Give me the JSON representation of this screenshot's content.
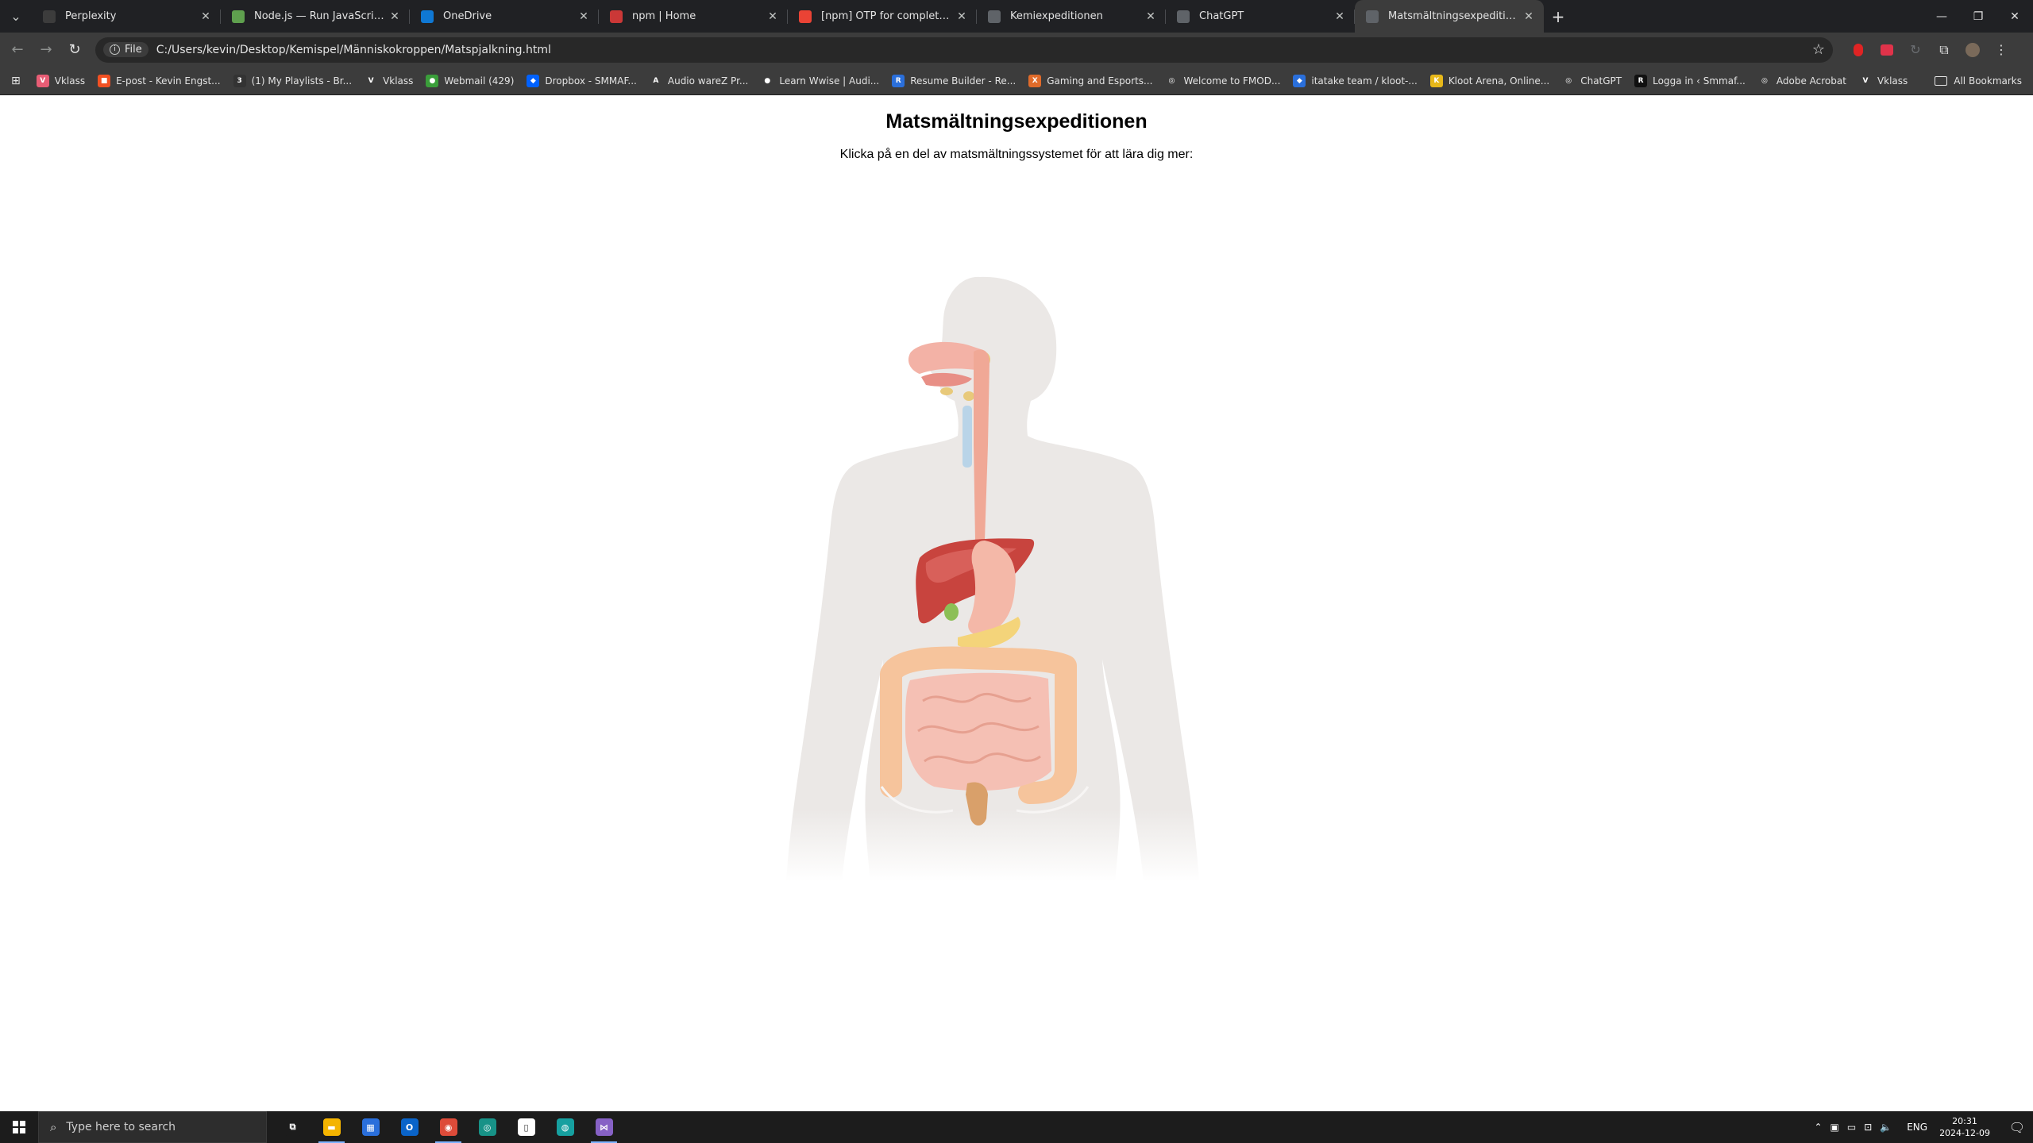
{
  "browser": {
    "tabs": [
      {
        "title": "Perplexity",
        "icon": "perplexity-icon",
        "color": "#3c3c3c",
        "active": false
      },
      {
        "title": "Node.js — Run JavaScript Every",
        "icon": "nodejs-icon",
        "color": "#5fa04e",
        "active": false
      },
      {
        "title": "OneDrive",
        "icon": "onedrive-icon",
        "color": "#0f78d4",
        "active": false
      },
      {
        "title": "npm | Home",
        "icon": "npm-icon",
        "color": "#cb3837",
        "active": false
      },
      {
        "title": "[npm] OTP for complete the sig",
        "icon": "gmail-icon",
        "color": "#ea4335",
        "active": false
      },
      {
        "title": "Kemiexpeditionen",
        "icon": "globe-icon",
        "color": "#5f6368",
        "active": false
      },
      {
        "title": "ChatGPT",
        "icon": "chatgpt-icon",
        "color": "#5f6368",
        "active": false
      },
      {
        "title": "Matsmältningsexpeditionen",
        "icon": "globe-icon",
        "color": "#5f6368",
        "active": true
      }
    ],
    "new_tab_label": "+",
    "file_chip": "File",
    "url": "C:/Users/kevin/Desktop/Kemispel/Människokroppen/Matspjalkning.html",
    "bookmarks": [
      {
        "label": "Vklass",
        "color": "#e85d75",
        "glyph": "V"
      },
      {
        "label": "E-post - Kevin Engst...",
        "color": "#f25022",
        "glyph": "■"
      },
      {
        "label": "(1) My Playlists - Br...",
        "color": "#333333",
        "glyph": "3"
      },
      {
        "label": "Vklass",
        "color": "#3c3c3c",
        "glyph": "V"
      },
      {
        "label": "Webmail (429)",
        "color": "#3a9e3a",
        "glyph": "●"
      },
      {
        "label": "Dropbox - SMMAF...",
        "color": "#0061fe",
        "glyph": "◆"
      },
      {
        "label": "Audio wareZ  Pr...",
        "color": "#3c3c3c",
        "glyph": "A"
      },
      {
        "label": "Learn Wwise | Audi...",
        "color": "#3c3c3c",
        "glyph": "●"
      },
      {
        "label": "Resume Builder - Re...",
        "color": "#2a6fdb",
        "glyph": "R"
      },
      {
        "label": "Gaming and Esports...",
        "color": "#e06b2a",
        "glyph": "X"
      },
      {
        "label": "Welcome to FMOD...",
        "color": "#3c3c3c",
        "glyph": "◎"
      },
      {
        "label": "itatake team / kloot-...",
        "color": "#2a6fdb",
        "glyph": "◆"
      },
      {
        "label": "Kloot Arena, Online...",
        "color": "#e7b81a",
        "glyph": "K"
      },
      {
        "label": "ChatGPT",
        "color": "#3c3c3c",
        "glyph": "◎"
      },
      {
        "label": "Logga in ‹ Smmaf...",
        "color": "#111111",
        "glyph": "R"
      },
      {
        "label": "Adobe Acrobat",
        "color": "#3c3c3c",
        "glyph": "◎"
      },
      {
        "label": "Vklass",
        "color": "#3c3c3c",
        "glyph": "V"
      }
    ],
    "all_bookmarks": "All Bookmarks"
  },
  "page": {
    "title": "Matsmältningsexpeditionen",
    "instruction": "Klicka på en del av matsmältningssystemet för att lära dig mer:"
  },
  "taskbar": {
    "search_placeholder": "Type here to search",
    "apps": [
      {
        "name": "task-view-icon",
        "color": "#1c1c1c",
        "glyph": "⧉",
        "running": false
      },
      {
        "name": "file-explorer-icon",
        "color": "#f4b400",
        "glyph": "▬",
        "running": true
      },
      {
        "name": "microsoft-store-icon",
        "color": "#2a6fdb",
        "glyph": "▦",
        "running": false
      },
      {
        "name": "outlook-icon",
        "color": "#0a64c9",
        "glyph": "O",
        "running": false
      },
      {
        "name": "chrome-icon",
        "color": "#dd4b39",
        "glyph": "◉",
        "running": true
      },
      {
        "name": "gitkraken-icon",
        "color": "#179287",
        "glyph": "◎",
        "running": false
      },
      {
        "name": "notepad-icon",
        "color": "#ffffff",
        "glyph": "▯",
        "running": false
      },
      {
        "name": "audio-app-icon",
        "color": "#16a0a0",
        "glyph": "◍",
        "running": false
      },
      {
        "name": "visual-studio-icon",
        "color": "#8661c5",
        "glyph": "⋈",
        "running": true
      }
    ],
    "language": "ENG",
    "time": "20:31",
    "date": "2024-12-09"
  }
}
